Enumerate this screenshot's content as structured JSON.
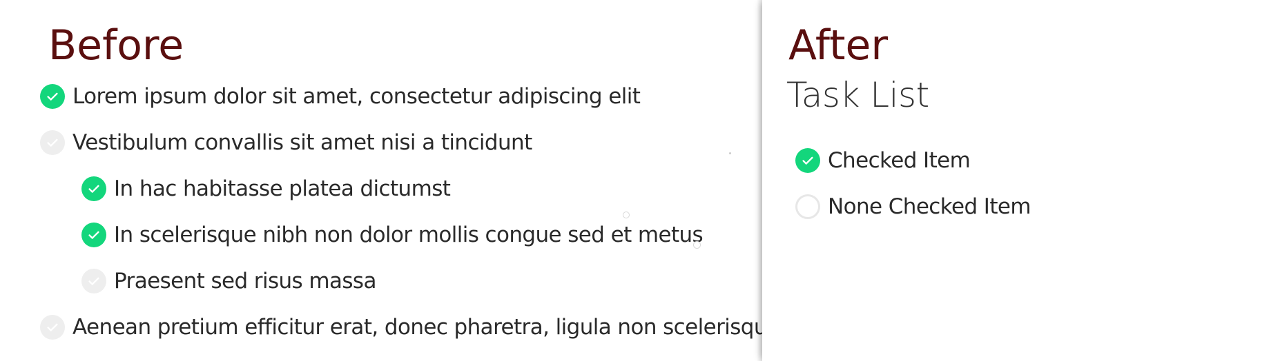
{
  "before": {
    "heading": "Before",
    "items": [
      {
        "label": "Lorem ipsum dolor sit amet, consectetur adipiscing elit",
        "checked": true
      },
      {
        "label": "Vestibulum convallis sit amet nisi a tincidunt",
        "checked": false
      },
      {
        "label": "In hac habitasse platea dictumst",
        "checked": true
      },
      {
        "label": "In scelerisque nibh non dolor mollis congue sed et metus",
        "checked": true
      },
      {
        "label": "Praesent sed risus massa",
        "checked": false
      },
      {
        "label": "Aenean pretium efficitur erat, donec pharetra, ligula non scelerisque",
        "checked": false
      }
    ]
  },
  "after": {
    "heading": "After",
    "subtitle": "Task List",
    "items": [
      {
        "label": "Checked Item",
        "checked": true
      },
      {
        "label": "None Checked Item",
        "checked": false
      }
    ]
  },
  "colors": {
    "heading": "#5a0f0f",
    "checked": "#13d67c",
    "unchecked": "#eeeeee"
  },
  "icons": {
    "checked": "check-circle-icon",
    "unchecked": "empty-circle-icon"
  }
}
